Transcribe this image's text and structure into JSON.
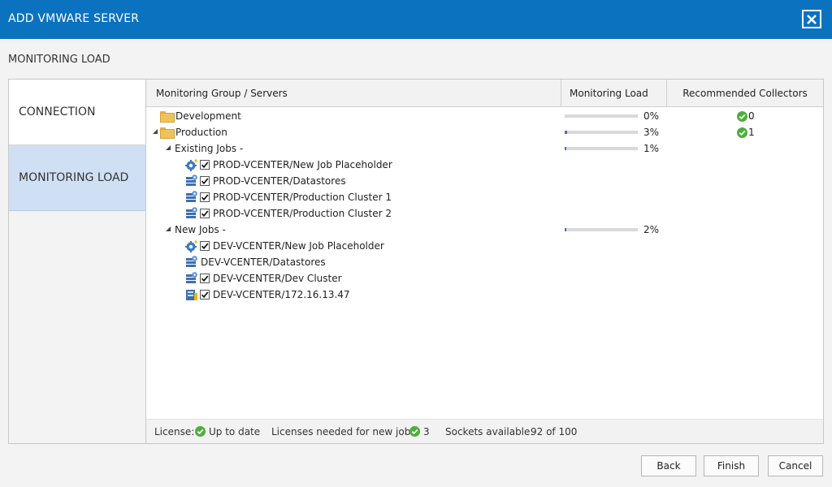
{
  "window": {
    "title": "ADD VMWARE SERVER"
  },
  "page": {
    "subtitle": "MONITORING LOAD"
  },
  "nav": {
    "items": [
      {
        "label": "CONNECTION",
        "selected": false
      },
      {
        "label": "MONITORING LOAD",
        "selected": true
      }
    ]
  },
  "grid": {
    "columns": [
      "Monitoring Group / Servers",
      "Monitoring Load",
      "Recommended Collectors"
    ],
    "rows": [
      {
        "label": "Development",
        "icon": "folder-icon",
        "load": "0%",
        "load_fraction": 0.0,
        "collectors": "0"
      },
      {
        "label": "Production",
        "icon": "folder-icon",
        "expanded": true,
        "load": "3%",
        "load_fraction": 0.03,
        "collectors": "1"
      },
      {
        "label": "Existing Jobs -",
        "expanded": true,
        "load": "1%",
        "load_fraction": 0.01
      },
      {
        "label": "PROD-VCENTER/New Job Placeholder",
        "icon": "placeholder-gear-icon",
        "checked": true
      },
      {
        "label": "PROD-VCENTER/Datastores",
        "icon": "datastore-icon",
        "checked": true
      },
      {
        "label": "PROD-VCENTER/Production Cluster 1",
        "icon": "cluster-icon",
        "checked": true
      },
      {
        "label": "PROD-VCENTER/Production Cluster 2",
        "icon": "cluster-icon",
        "checked": true
      },
      {
        "label": "New Jobs -",
        "expanded": true,
        "load": "2%",
        "load_fraction": 0.02
      },
      {
        "label": "DEV-VCENTER/New Job Placeholder",
        "icon": "placeholder-gear-icon",
        "checked": true
      },
      {
        "label": "DEV-VCENTER/Datastores",
        "icon": "datastore-icon"
      },
      {
        "label": "DEV-VCENTER/Dev Cluster",
        "icon": "cluster-icon",
        "checked": true
      },
      {
        "label": "DEV-VCENTER/172.16.13.47",
        "icon": "host-icon",
        "checked": true
      }
    ]
  },
  "status": {
    "license_label": "License:",
    "license_value": "Up to date",
    "licenses_needed_label": "Licenses needed for new jobs:",
    "licenses_needed_value": "3",
    "sockets_label": "Sockets available:",
    "sockets_value": "92 of 100"
  },
  "buttons": {
    "back": "Back",
    "finish": "Finish",
    "cancel": "Cancel"
  },
  "colors": {
    "title_bar": "#0b72c0",
    "selected_nav": "#cfe0f5",
    "ok_green": "#4caf3a",
    "load_bar": "#3f74b8"
  }
}
